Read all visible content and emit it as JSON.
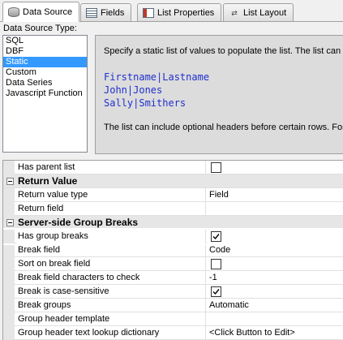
{
  "tabs": [
    {
      "label": "Data Source",
      "icon": "database-icon",
      "active": true
    },
    {
      "label": "Fields",
      "icon": "fields-icon",
      "active": false
    },
    {
      "label": "List Properties",
      "icon": "list-properties-icon",
      "active": false
    },
    {
      "label": "List Layout",
      "icon": "list-layout-icon",
      "active": false
    }
  ],
  "data_source": {
    "label": "Data Source Type:",
    "types": [
      "SQL",
      "DBF",
      "Static",
      "Custom",
      "Data Series",
      "Javascript Function"
    ],
    "selected": "Static"
  },
  "description": {
    "intro": "Specify a static list of values to populate the list. The list can h",
    "example_lines": [
      "Firstname|Lastname",
      "John|Jones",
      "Sally|Smithers"
    ],
    "note": "The list can include optional headers before certain rows. For"
  },
  "properties": {
    "has_parent_list": {
      "label": "Has parent list",
      "checked": false
    },
    "return_value_category": "Return Value",
    "return_value_type": {
      "label": "Return value type",
      "value": "Field"
    },
    "return_field": {
      "label": "Return field",
      "value": ""
    },
    "group_breaks_category": "Server-side Group Breaks",
    "has_group_breaks": {
      "label": "Has group breaks",
      "checked": true
    },
    "break_field": {
      "label": "Break field",
      "value": "Code"
    },
    "sort_on_break_field": {
      "label": "Sort on break field",
      "checked": false
    },
    "break_field_chars": {
      "label": "Break field characters to check",
      "value": "-1"
    },
    "break_case_sensitive": {
      "label": "Break is case-sensitive",
      "checked": true
    },
    "break_groups": {
      "label": "Break groups",
      "value": "Automatic"
    },
    "group_header_template": {
      "label": "Group header template",
      "value": ""
    },
    "group_header_lookup": {
      "label": "Group header text lookup dictionary",
      "value": "<Click Button to Edit>"
    }
  },
  "colors": {
    "selection": "#3399ff",
    "example_text": "#1f2fcf",
    "category_bg": "#e6e6e6"
  }
}
